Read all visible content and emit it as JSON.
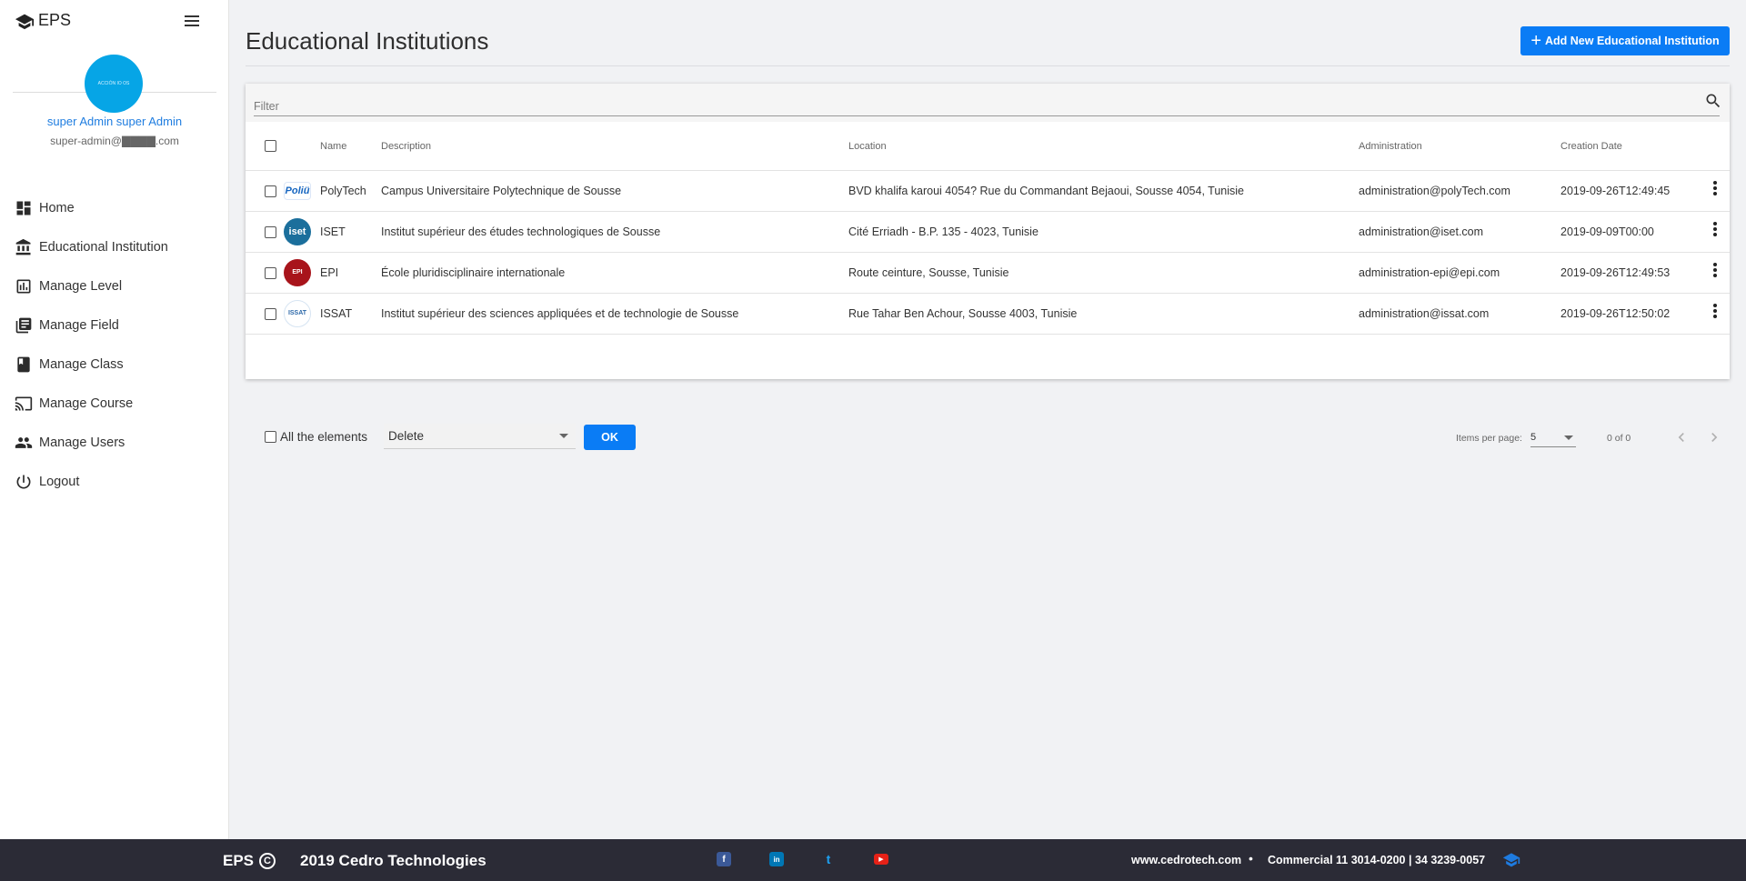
{
  "sidebar": {
    "brand": "EPS",
    "avatar_text": "ACCIÓN IO OS",
    "user_name": "super Admin super Admin",
    "user_email": "super-admin@▇▇▇▇.com",
    "items": [
      {
        "label": "Home",
        "icon": "dashboard-icon"
      },
      {
        "label": "Educational Institution",
        "icon": "institution-icon"
      },
      {
        "label": "Manage Level",
        "icon": "chart-icon"
      },
      {
        "label": "Manage Field",
        "icon": "library-icon"
      },
      {
        "label": "Manage Class",
        "icon": "book-icon"
      },
      {
        "label": "Manage Course",
        "icon": "cast-icon"
      },
      {
        "label": "Manage Users",
        "icon": "people-icon"
      },
      {
        "label": "Logout",
        "icon": "power-icon"
      }
    ]
  },
  "header": {
    "title": "Educational Institutions",
    "add_label": "Add New Educational Institution"
  },
  "filter": {
    "placeholder": "Filter"
  },
  "table": {
    "columns": [
      "Name",
      "Description",
      "Location",
      "Administration",
      "Creation Date"
    ],
    "rows": [
      {
        "logo": "Poliü",
        "name": "PolyTech",
        "description": "Campus Universitaire Polytechnique de Sousse",
        "location": "BVD khalifa karoui 4054? Rue du Commandant Bejaoui, Sousse 4054, Tunisie",
        "administration": "administration@polyTech.com",
        "created": "2019-09-26T12:49:45"
      },
      {
        "logo": "iset",
        "name": "ISET",
        "description": "Institut supérieur des études technologiques de Sousse",
        "location": "Cité Erriadh - B.P. 135 - 4023, Tunisie",
        "administration": "administration@iset.com",
        "created": "2019-09-09T00:00"
      },
      {
        "logo": "EPI",
        "name": "EPI",
        "description": "École pluridisciplinaire internationale",
        "location": "Route ceinture, Sousse, Tunisie",
        "administration": "administration-epi@epi.com",
        "created": "2019-09-26T12:49:53"
      },
      {
        "logo": "ISSAT",
        "name": "ISSAT",
        "description": "Institut supérieur des sciences appliquées et de technologie de Sousse",
        "location": "Rue Tahar Ben Achour, Sousse 4003, Tunisie",
        "administration": "administration@issat.com",
        "created": "2019-09-26T12:50:02"
      }
    ]
  },
  "bulk": {
    "all_label": "All the elements",
    "action": "Delete",
    "ok_label": "OK"
  },
  "pagination": {
    "items_per_page_label": "Items per page:",
    "items_per_page": "5",
    "range": "0 of 0"
  },
  "footer": {
    "brand": "EPS",
    "copyright_symbol": "C",
    "company": "2019 Cedro Technologies",
    "social": [
      {
        "icon": "facebook-icon",
        "glyph": "f",
        "color": "#3b5998"
      },
      {
        "icon": "linkedin-icon",
        "glyph": "in",
        "color": "#0077b5"
      },
      {
        "icon": "twitter-icon",
        "glyph": "t",
        "color": "#1da1f2"
      },
      {
        "icon": "youtube-icon",
        "glyph": "▶",
        "color": "#e62117"
      }
    ],
    "website": "www.cedrotech.com",
    "separator": "•",
    "phone": "Commercial 11 3014-0200 | 34 3239-0057"
  },
  "colors": {
    "accent": "#0a7cf5",
    "footer_bg": "#2b2b36",
    "avatar": "#06a5e6"
  }
}
